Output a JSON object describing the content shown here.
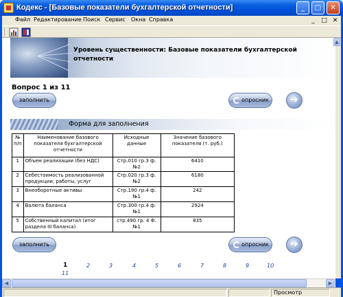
{
  "window": {
    "title": "Кодекс - [Базовые показатели бухгалтерской отчетности]",
    "minimize_glyph": "_",
    "maximize_glyph": "□",
    "close_glyph": "✕"
  },
  "menu": {
    "items": [
      "Файл",
      "Редактирование",
      "Поиск",
      "Сервис",
      "Окна",
      "Справка"
    ],
    "right_buttons": [
      "_",
      "□",
      "✕"
    ]
  },
  "toolbar": {
    "icons": [
      "chart-icon",
      "book-icon"
    ]
  },
  "banner": {
    "title": "Уровень существенности: Базовые показатели бухгалтерской отчетности"
  },
  "question": {
    "text": "Вопрос 1 из 11"
  },
  "buttons": {
    "fill_label": "заполнить",
    "survey_label": "опросник",
    "next_glyph": "➔"
  },
  "form": {
    "title": "Форма для заполнения",
    "columns": [
      "№ п/п",
      "Наименование базового показателя бухгалтерской отчетности",
      "Исходные данные",
      "Значение базового показателя (т. руб.)"
    ],
    "rows": [
      {
        "num": "1",
        "name": "Объем реализации (без НДС)",
        "source": "Стр.010 гр.3 ф.№2",
        "value": "6410"
      },
      {
        "num": "2",
        "name": "Себестоимость реализованной продукции, работы, услуг",
        "source": "Стр.020 гр.3 ф.№2",
        "value": "6180"
      },
      {
        "num": "3",
        "name": "Внеоборотные активы",
        "source": "Стр.190 гр.4 ф.№1",
        "value": "242"
      },
      {
        "num": "4",
        "name": "Валюта баланса",
        "source": "Стр.300 гр.4 ф.№1",
        "value": "2924"
      },
      {
        "num": "5",
        "name": "Собственный капитал (итог раздела III баланса)",
        "source": "стр.490 гр. 4 Ф.№1",
        "value": "835"
      }
    ]
  },
  "pagination": {
    "current": "1",
    "pages": [
      "2",
      "3",
      "4",
      "5",
      "6",
      "7",
      "8",
      "9",
      "10",
      "11"
    ]
  },
  "scroll": {
    "up_glyph": "▲",
    "left_glyph": "◀",
    "right_glyph": "▶"
  },
  "status": {
    "mode": "Просмотр"
  }
}
